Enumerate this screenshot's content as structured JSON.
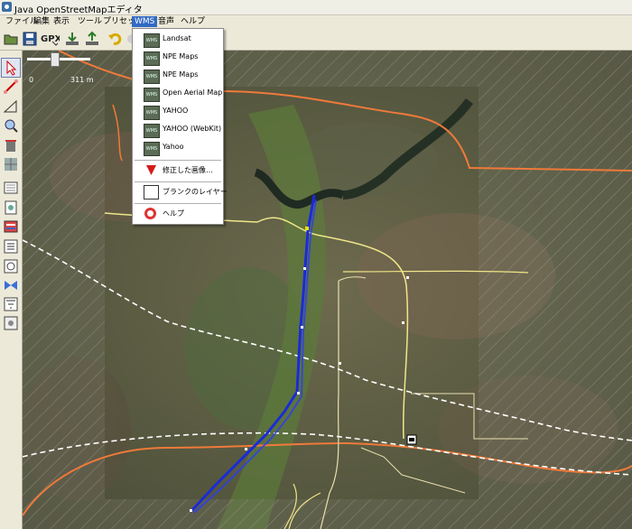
{
  "window": {
    "title": "Java OpenStreetMapエディタ"
  },
  "menubar": {
    "items": [
      {
        "label": "ファイル"
      },
      {
        "label": "編集"
      },
      {
        "label": "表示"
      },
      {
        "label": "ツール"
      },
      {
        "label": "プリセット"
      },
      {
        "label": "WMS"
      },
      {
        "label": "音声"
      },
      {
        "label": "ヘルプ"
      }
    ],
    "active": "WMS"
  },
  "toolbar": {
    "gpx_label": "GPX",
    "icons": [
      "open-icon",
      "save-icon",
      "gpx-icon",
      "download-icon",
      "upload-icon",
      "undo-icon",
      "redo-icon"
    ]
  },
  "left_toolbar": {
    "icons": [
      "select-icon",
      "draw-icon",
      "extrude-icon",
      "zoom-icon",
      "delete-icon",
      "grid-icon",
      "layer-icon",
      "properties-icon",
      "relation-icon",
      "list-icon",
      "history-icon",
      "conflict-icon",
      "filter-icon",
      "settings-icon"
    ]
  },
  "scale": {
    "min": "0",
    "max": "311 m"
  },
  "wms_menu": {
    "items": [
      {
        "label": "Landsat",
        "icon": "WMS"
      },
      {
        "label": "NPE Maps",
        "icon": "WMS"
      },
      {
        "label": "NPE Maps",
        "icon": "WMS"
      },
      {
        "label": "Open Aerial Map",
        "icon": "WMS"
      },
      {
        "label": "YAHOO",
        "icon": "WMS"
      },
      {
        "label": "YAHOO (WebKit)",
        "icon": "WMS"
      },
      {
        "label": "Yahoo",
        "icon": "WMS"
      }
    ],
    "adjust": "修正した画像…",
    "blank": "ブランクのレイヤー",
    "help": "ヘルプ"
  },
  "colors": {
    "accent": "#316ac5",
    "track": "#1a2bd8",
    "road_orange": "#f07a3a",
    "road_yellow": "#f0e68a"
  }
}
